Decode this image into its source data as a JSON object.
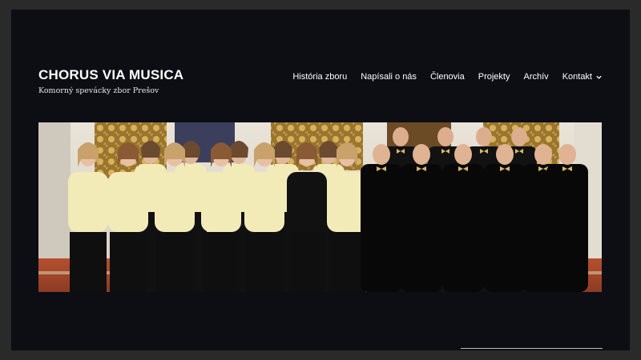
{
  "site": {
    "title": "CHORUS VIA MUSICA",
    "description": "Komorný spevácky zbor Prešov"
  },
  "nav": {
    "items": [
      {
        "label": "História zboru"
      },
      {
        "label": "Napísali o nás"
      },
      {
        "label": "Členovia"
      },
      {
        "label": "Projekty"
      },
      {
        "label": "Archív"
      },
      {
        "label": "Kontakt",
        "has_dropdown": true
      }
    ]
  },
  "colors": {
    "page_background": "#0d0e14",
    "outer_border": "#2a2a2a",
    "text": "#ffffff",
    "women_blouse": "#f2ebb8",
    "men_shirt": "#121212",
    "bow_tie": "#d9b96a",
    "gold_ornament": "#b8903a"
  },
  "hero": {
    "subject": "choir-group-photo",
    "women_count": 13,
    "men_count": 10
  }
}
